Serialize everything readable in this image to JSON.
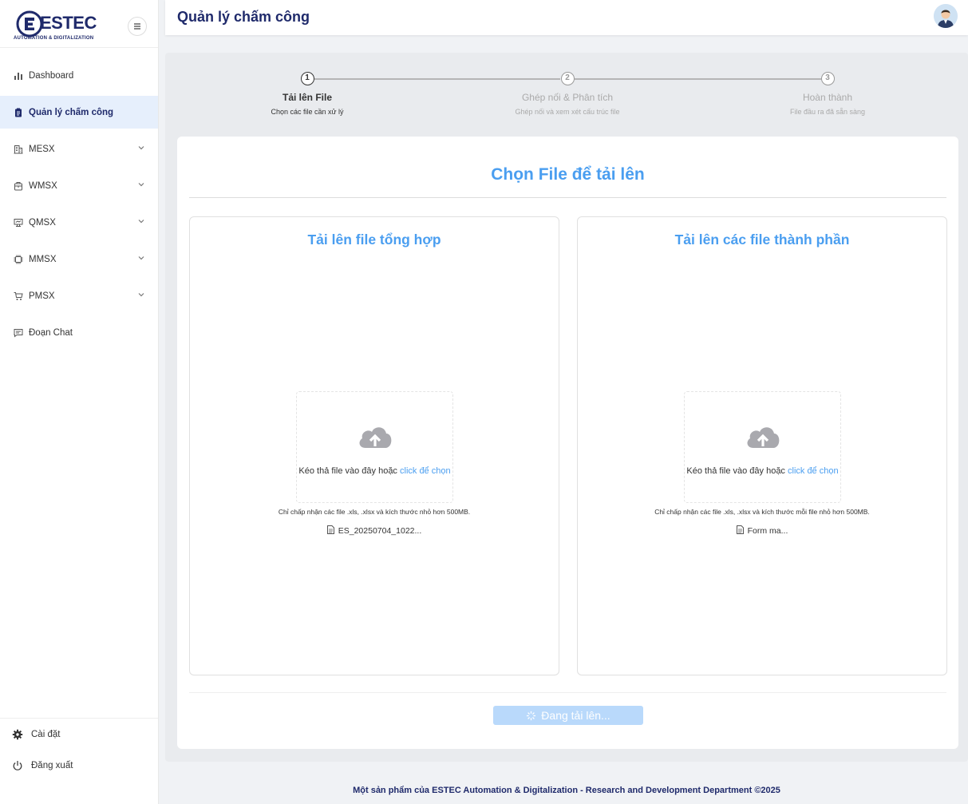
{
  "brand": {
    "name": "ESTEC",
    "tagline": "AUTOMATION & DIGITALIZATION",
    "primary_color": "#1f2a6b",
    "accent_color": "#4a9ef0"
  },
  "sidebar": {
    "toggle_icon": "menu-icon",
    "items": [
      {
        "label": "Dashboard",
        "icon": "bar-chart-icon",
        "has_submenu": false,
        "active": false
      },
      {
        "label": "Quản lý chấm công",
        "icon": "clipboard-icon",
        "has_submenu": false,
        "active": true
      },
      {
        "label": "MESX",
        "icon": "building-icon",
        "has_submenu": true,
        "active": false
      },
      {
        "label": "WMSX",
        "icon": "package-icon",
        "has_submenu": true,
        "active": false
      },
      {
        "label": "QMSX",
        "icon": "monitor-icon",
        "has_submenu": true,
        "active": false
      },
      {
        "label": "MMSX",
        "icon": "chip-icon",
        "has_submenu": true,
        "active": false
      },
      {
        "label": "PMSX",
        "icon": "cart-icon",
        "has_submenu": true,
        "active": false
      },
      {
        "label": "Đoạn Chat",
        "icon": "chat-icon",
        "has_submenu": false,
        "active": false
      }
    ],
    "bottom": [
      {
        "label": "Cài đặt",
        "icon": "gear-icon"
      },
      {
        "label": "Đăng xuất",
        "icon": "power-icon"
      }
    ]
  },
  "header": {
    "title": "Quản lý chấm công"
  },
  "steps": [
    {
      "number": "1",
      "title": "Tải lên File",
      "desc": "Chọn các file cần xử lý",
      "state": "active"
    },
    {
      "number": "2",
      "title": "Ghép nối & Phân tích",
      "desc": "Ghép nối và xem xét cấu trúc file",
      "state": "pending"
    },
    {
      "number": "3",
      "title": "Hoàn thành",
      "desc": "File đầu ra đã sẵn sàng",
      "state": "pending"
    }
  ],
  "main": {
    "title": "Chọn File để tải lên",
    "panels": [
      {
        "title": "Tải lên file tổng hợp",
        "drop_text": "Kéo thả file vào đây hoặc",
        "drop_link": "click để chọn",
        "accept_note": "Chỉ chấp nhận các file .xls, .xlsx và kích thước nhỏ hơn 500MB.",
        "file_name": "ES_20250704_1022..."
      },
      {
        "title": "Tải lên các file thành phần",
        "drop_text": "Kéo thả file vào đây hoặc",
        "drop_link": "click để chọn",
        "accept_note": "Chỉ chấp nhận các file .xls, .xlsx và kích thước mỗi file nhỏ hơn 500MB.",
        "file_name": "Form ma..."
      }
    ],
    "upload_button": "Đang tải lên..."
  },
  "footer": {
    "text": "Một sản phẩm của ESTEC Automation & Digitalization - Research and Development Department ©2025"
  }
}
